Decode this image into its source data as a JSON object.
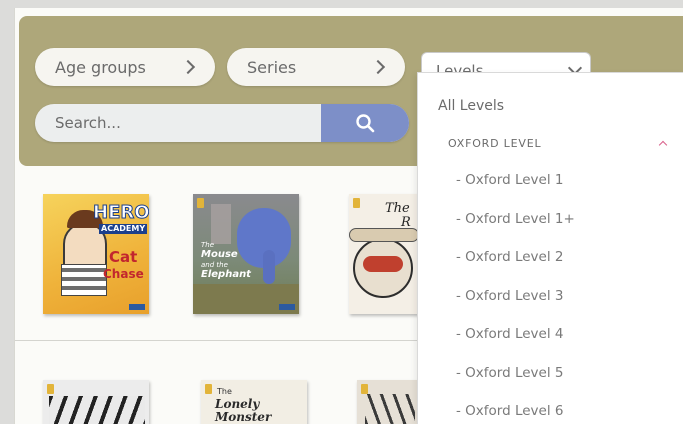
{
  "filters": {
    "age_groups_label": "Age groups",
    "series_label": "Series",
    "levels_label": "Levels",
    "search_placeholder": "Search..."
  },
  "levels_dropdown": {
    "all_label": "All Levels",
    "group_label": "OXFORD LEVEL",
    "items": [
      "- Oxford Level 1",
      "- Oxford Level 1+",
      "- Oxford Level 2",
      "- Oxford Level 3",
      "- Oxford Level 4",
      "- Oxford Level 5",
      "- Oxford Level 6"
    ]
  },
  "books": {
    "row1": [
      {
        "title_1": "HERO",
        "title_2": "ACADEMY",
        "title_3": "Cat",
        "title_4": "Chase"
      },
      {
        "title_1": "The",
        "title_2": "Mouse",
        "title_3": "and the",
        "title_4": "Elephant"
      },
      {
        "title_1": "The",
        "title_2": "R"
      }
    ],
    "row2": [
      {
        "title_1": ""
      },
      {
        "title_1": "The",
        "title_2": "Lonely Monster"
      },
      {
        "title_1": ""
      }
    ]
  },
  "colors": {
    "filter_bar": "#aea77a",
    "search_button": "#7d8fc8",
    "caret_accent": "#d95f8a"
  },
  "icons": {
    "search": "magnifier-icon",
    "chevron_right": "chevron-right-icon",
    "chevron_down": "chevron-down-icon",
    "caret_up": "caret-up-icon"
  }
}
